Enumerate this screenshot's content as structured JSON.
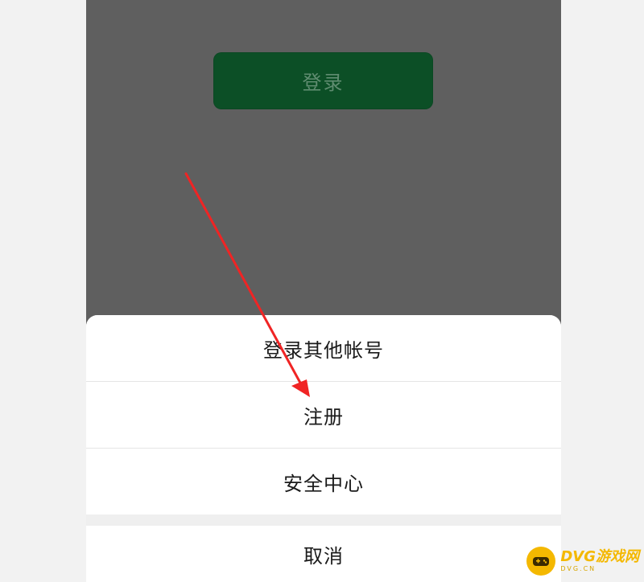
{
  "login_button": {
    "label": "登录"
  },
  "action_sheet": {
    "items": [
      {
        "label": "登录其他帐号"
      },
      {
        "label": "注册"
      },
      {
        "label": "安全中心"
      }
    ],
    "cancel_label": "取消"
  },
  "watermark": {
    "title": "DVG游戏网",
    "subtitle": "DVG.CN"
  },
  "colors": {
    "overlay": "#5f5f5f",
    "login_button": "#0c4f26",
    "annotation_arrow": "#f02424",
    "watermark": "#f4b800"
  }
}
